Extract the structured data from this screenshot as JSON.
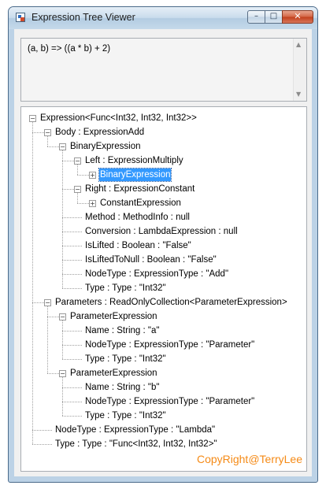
{
  "window": {
    "title": "Expression Tree Viewer",
    "min_glyph": "–",
    "max_glyph": "□",
    "close_glyph": "✕"
  },
  "expression_text": "(a, b) => ((a * b) + 2)",
  "scroll": {
    "up": "▲",
    "down": "▼"
  },
  "tree": {
    "nodes": [
      {
        "label": "Expression<Func<Int32, Int32, Int32>>",
        "level": 0,
        "expander": "minus",
        "name": "tree-node-root"
      },
      {
        "label": "Body : ExpressionAdd",
        "level": 1,
        "expander": "minus",
        "name": "tree-node-body"
      },
      {
        "label": "BinaryExpression",
        "level": 2,
        "expander": "minus",
        "name": "tree-node-binary-expression"
      },
      {
        "label": "Left : ExpressionMultiply",
        "level": 3,
        "expander": "minus",
        "name": "tree-node-left"
      },
      {
        "label": "BinaryExpression",
        "level": 4,
        "expander": "plus",
        "selected": true,
        "name": "tree-node-left-binary-expression"
      },
      {
        "label": "Right : ExpressionConstant",
        "level": 3,
        "expander": "minus",
        "name": "tree-node-right"
      },
      {
        "label": "ConstantExpression",
        "level": 4,
        "expander": "plus",
        "name": "tree-node-constant-expression"
      },
      {
        "label": "Method : MethodInfo : null",
        "level": 3,
        "expander": "none",
        "name": "tree-node-method"
      },
      {
        "label": "Conversion : LambdaExpression : null",
        "level": 3,
        "expander": "none",
        "name": "tree-node-conversion"
      },
      {
        "label": "IsLifted : Boolean : \"False\"",
        "level": 3,
        "expander": "none",
        "name": "tree-node-islifted"
      },
      {
        "label": "IsLiftedToNull : Boolean : \"False\"",
        "level": 3,
        "expander": "none",
        "name": "tree-node-isliftedtonull"
      },
      {
        "label": "NodeType : ExpressionType : \"Add\"",
        "level": 3,
        "expander": "none",
        "name": "tree-node-nodetype-add"
      },
      {
        "label": "Type : Type : \"Int32\"",
        "level": 3,
        "expander": "none",
        "name": "tree-node-type-int32"
      },
      {
        "label": "Parameters : ReadOnlyCollection<ParameterExpression>",
        "level": 1,
        "expander": "minus",
        "name": "tree-node-parameters"
      },
      {
        "label": "ParameterExpression",
        "level": 2,
        "expander": "minus",
        "name": "tree-node-parameter-a"
      },
      {
        "label": "Name : String : \"a\"",
        "level": 3,
        "expander": "none",
        "name": "tree-node-name-a"
      },
      {
        "label": "NodeType : ExpressionType : \"Parameter\"",
        "level": 3,
        "expander": "none",
        "name": "tree-node-nodetype-param-a"
      },
      {
        "label": "Type : Type : \"Int32\"",
        "level": 3,
        "expander": "none",
        "name": "tree-node-type-a"
      },
      {
        "label": "ParameterExpression",
        "level": 2,
        "expander": "minus",
        "name": "tree-node-parameter-b"
      },
      {
        "label": "Name : String : \"b\"",
        "level": 3,
        "expander": "none",
        "name": "tree-node-name-b"
      },
      {
        "label": "NodeType : ExpressionType : \"Parameter\"",
        "level": 3,
        "expander": "none",
        "name": "tree-node-nodetype-param-b"
      },
      {
        "label": "Type : Type : \"Int32\"",
        "level": 3,
        "expander": "none",
        "name": "tree-node-type-b"
      },
      {
        "label": "NodeType : ExpressionType : \"Lambda\"",
        "level": 1,
        "expander": "none",
        "name": "tree-node-nodetype-lambda"
      },
      {
        "label": "Type : Type : \"Func<Int32, Int32, Int32>\"",
        "level": 1,
        "expander": "none",
        "name": "tree-node-type-func"
      }
    ]
  },
  "watermark": "CopyRight@TerryLee",
  "colors": {
    "selection": "#3399ff",
    "watermark": "#f58a16"
  }
}
